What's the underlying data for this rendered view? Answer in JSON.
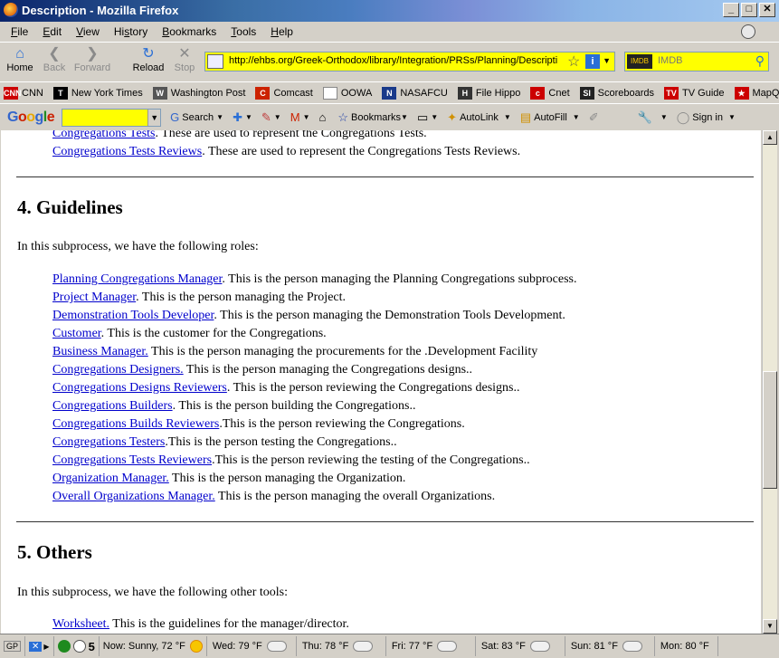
{
  "window": {
    "title": "Description - Mozilla Firefox"
  },
  "menu": [
    {
      "pre": "",
      "ul": "F",
      "post": "ile"
    },
    {
      "pre": "",
      "ul": "E",
      "post": "dit"
    },
    {
      "pre": "",
      "ul": "V",
      "post": "iew"
    },
    {
      "pre": "Hi",
      "ul": "s",
      "post": "tory"
    },
    {
      "pre": "",
      "ul": "B",
      "post": "ookmarks"
    },
    {
      "pre": "",
      "ul": "T",
      "post": "ools"
    },
    {
      "pre": "",
      "ul": "H",
      "post": "elp"
    }
  ],
  "nav": {
    "home": "Home",
    "back": "Back",
    "forward": "Forward",
    "reload": "Reload",
    "stop": "Stop",
    "url": "http://ehbs.org/Greek-Orthodox/library/Integration/PRSs/Planning/Descripti",
    "search_engine": "IMDB",
    "search_placeholder": "IMDB"
  },
  "bookmarks": [
    {
      "label": "CNN",
      "icon": "cnn-icon",
      "color": "#cc0000",
      "glyph": "CNN"
    },
    {
      "label": "New York Times",
      "icon": "nyt-icon",
      "color": "#000000",
      "glyph": "T"
    },
    {
      "label": "Washington Post",
      "icon": "wapo-icon",
      "color": "#555555",
      "glyph": "W"
    },
    {
      "label": "Comcast",
      "icon": "comcast-icon",
      "color": "#cc2200",
      "glyph": "C"
    },
    {
      "label": "OOWA",
      "icon": "page-icon",
      "color": "#ffffff",
      "glyph": ""
    },
    {
      "label": "NASAFCU",
      "icon": "nasa-icon",
      "color": "#1a3a8a",
      "glyph": "N"
    },
    {
      "label": "File Hippo",
      "icon": "filehippo-icon",
      "color": "#333333",
      "glyph": "H"
    },
    {
      "label": "Cnet",
      "icon": "cnet-icon",
      "color": "#cc0000",
      "glyph": "c"
    },
    {
      "label": "Scoreboards",
      "icon": "si-icon",
      "color": "#222222",
      "glyph": "SI"
    },
    {
      "label": "TV Guide",
      "icon": "tvguide-icon",
      "color": "#cc0000",
      "glyph": "TV"
    },
    {
      "label": "MapQuest",
      "icon": "mapquest-icon",
      "color": "#cc0000",
      "glyph": "★"
    }
  ],
  "google_toolbar": {
    "search": "Search",
    "bookmarks": "Bookmarks",
    "autolink": "AutoLink",
    "autofill": "AutoFill",
    "signin": "Sign in"
  },
  "content": {
    "top_items": [
      {
        "link": "Congregations Tests",
        "text": ". These are used to represent the Congregations Tests."
      },
      {
        "link": "Congregations Tests Reviews",
        "text": ". These are used to represent the Congregations Tests Reviews."
      }
    ],
    "section4_title": "4. Guidelines",
    "section4_intro": "In this subprocess, we have the following roles:",
    "roles": [
      {
        "link": "Planning Congregations Manager",
        "text": ". This is the person managing the Planning Congregations subprocess."
      },
      {
        "link": "Project Manager",
        "text": ". This is the person managing the Project."
      },
      {
        "link": "Demonstration Tools Developer",
        "text": ". This is the person managing the Demonstration Tools Development."
      },
      {
        "link": "Customer",
        "text": ". This is the customer for the Congregations."
      },
      {
        "link": "Business Manager.",
        "text": " This is the person managing the procurements for the .Development Facility"
      },
      {
        "link": "Congregations Designers.",
        "text": " This is the person managing the Congregations designs.."
      },
      {
        "link": "Congregations Designs Reviewers",
        "text": ". This is the person reviewing the Congregations designs.."
      },
      {
        "link": "Congregations Builders",
        "text": ". This is the person building the Congregations.."
      },
      {
        "link": "Congregations Builds Reviewers",
        "text": ".This is the person reviewing the Congregations."
      },
      {
        "link": "Congregations Testers",
        "text": ".This is the person testing the Congregations.."
      },
      {
        "link": "Congregations Tests Reviewers",
        "text": ".This is the person reviewing the testing of the Congregations.."
      },
      {
        "link": "Organization Manager.",
        "text": " This is the person managing the Organization."
      },
      {
        "link": "Overall Organizations Manager.",
        "text": " This is the person managing the overall Organizations."
      }
    ],
    "section5_title": "5. Others",
    "section5_intro": "In this subprocess, we have the following other tools:",
    "tools": [
      {
        "link": "Worksheet.",
        "text": " This is the guidelines for the manager/director."
      }
    ]
  },
  "status": {
    "gp": "GP",
    "count": "5",
    "now": "Now: Sunny, 72 °F",
    "forecast": [
      {
        "label": "Wed: 79 °F"
      },
      {
        "label": "Thu: 78 °F"
      },
      {
        "label": "Fri: 77 °F"
      },
      {
        "label": "Sat: 83 °F"
      },
      {
        "label": "Sun: 81 °F"
      },
      {
        "label": "Mon: 80 °F"
      }
    ]
  }
}
